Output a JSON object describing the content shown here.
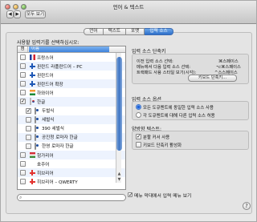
{
  "window": {
    "title": "언어 & 텍스트",
    "show_all": "모두 보기",
    "nav_back": "◀",
    "nav_forward": "▶"
  },
  "tabs": [
    {
      "label": "언어",
      "active": false
    },
    {
      "label": "텍스트",
      "active": false
    },
    {
      "label": "포맷",
      "active": false
    },
    {
      "label": "입력 소스",
      "active": true
    }
  ],
  "instruction": "사용할 입력기를 선택하십시오:",
  "list": {
    "headers": {
      "on": "켬",
      "name": "이름"
    },
    "items": [
      {
        "label": "프랑스어",
        "checked": false,
        "icon": "flag-france-icon",
        "indent": false
      },
      {
        "label": "핀란드 라플란드어 – PC",
        "checked": false,
        "icon": "flag-finland-icon",
        "indent": false
      },
      {
        "label": "핀란드어",
        "checked": false,
        "icon": "flag-finland-icon",
        "indent": false
      },
      {
        "label": "핀란드어 확장",
        "checked": false,
        "icon": "flag-finland-icon",
        "indent": false
      },
      {
        "label": "하와이어",
        "checked": false,
        "icon": "flag-hawaii-icon",
        "indent": false
      },
      {
        "label": "한글",
        "checked": true,
        "icon": "korean-icon",
        "indent": false
      },
      {
        "label": "두벌식",
        "checked": true,
        "icon": "korean-mode-icon",
        "indent": true
      },
      {
        "label": "세벌식",
        "checked": false,
        "icon": "korean-mode-icon",
        "indent": true
      },
      {
        "label": "390 세벌식",
        "checked": false,
        "icon": "korean-mode-icon",
        "indent": true
      },
      {
        "label": "공진청 로마자 한글",
        "checked": false,
        "icon": "korean-mode-icon",
        "indent": true
      },
      {
        "label": "한영 로마자 한글",
        "checked": false,
        "icon": "korean-mode-icon",
        "indent": true
      },
      {
        "label": "헝가리어",
        "checked": false,
        "icon": "flag-hungary-icon",
        "indent": false
      },
      {
        "label": "호주어",
        "checked": false,
        "icon": "flag-australia-icon",
        "indent": false
      },
      {
        "label": "히브리어",
        "checked": false,
        "icon": "hebrew-icon",
        "indent": false
      },
      {
        "label": "히브리어 – QWERTY",
        "checked": false,
        "icon": "hebrew-icon",
        "indent": false
      }
    ]
  },
  "search": {
    "placeholder": "",
    "value": ""
  },
  "input_source_shortcuts": {
    "title": "입력 소스 단축키",
    "rows": [
      {
        "label": "이전 입력 소스 선택:",
        "value": "⌘스페이스"
      },
      {
        "label": "메뉴에서 다음 입력 소스 선택:",
        "value": "⌥⌘스페이스"
      },
      {
        "label": "트랙패드 사용 스타일 보기(시각):",
        "value": "^스스페이스"
      }
    ],
    "button": "키보드 단축키..."
  },
  "input_source_options": {
    "title": "입력 소스 옵션",
    "options": [
      {
        "label": "모든 도큐멘트에 동일한 입력 소스 사용",
        "selected": true
      },
      {
        "label": "각 도큐멘트에 대해 다른 입력 소스 허용",
        "selected": false
      }
    ]
  },
  "bidi_text": {
    "title": "양방향 텍스트:",
    "options": [
      {
        "label": "분할 커서 사용",
        "checked": true
      },
      {
        "label": "키보드 단축키 활성화",
        "checked": false
      }
    ]
  },
  "bottom": {
    "show_menu": "메뉴 막대에서 입력 메뉴 보기",
    "show_menu_checked": true,
    "help": "?"
  }
}
